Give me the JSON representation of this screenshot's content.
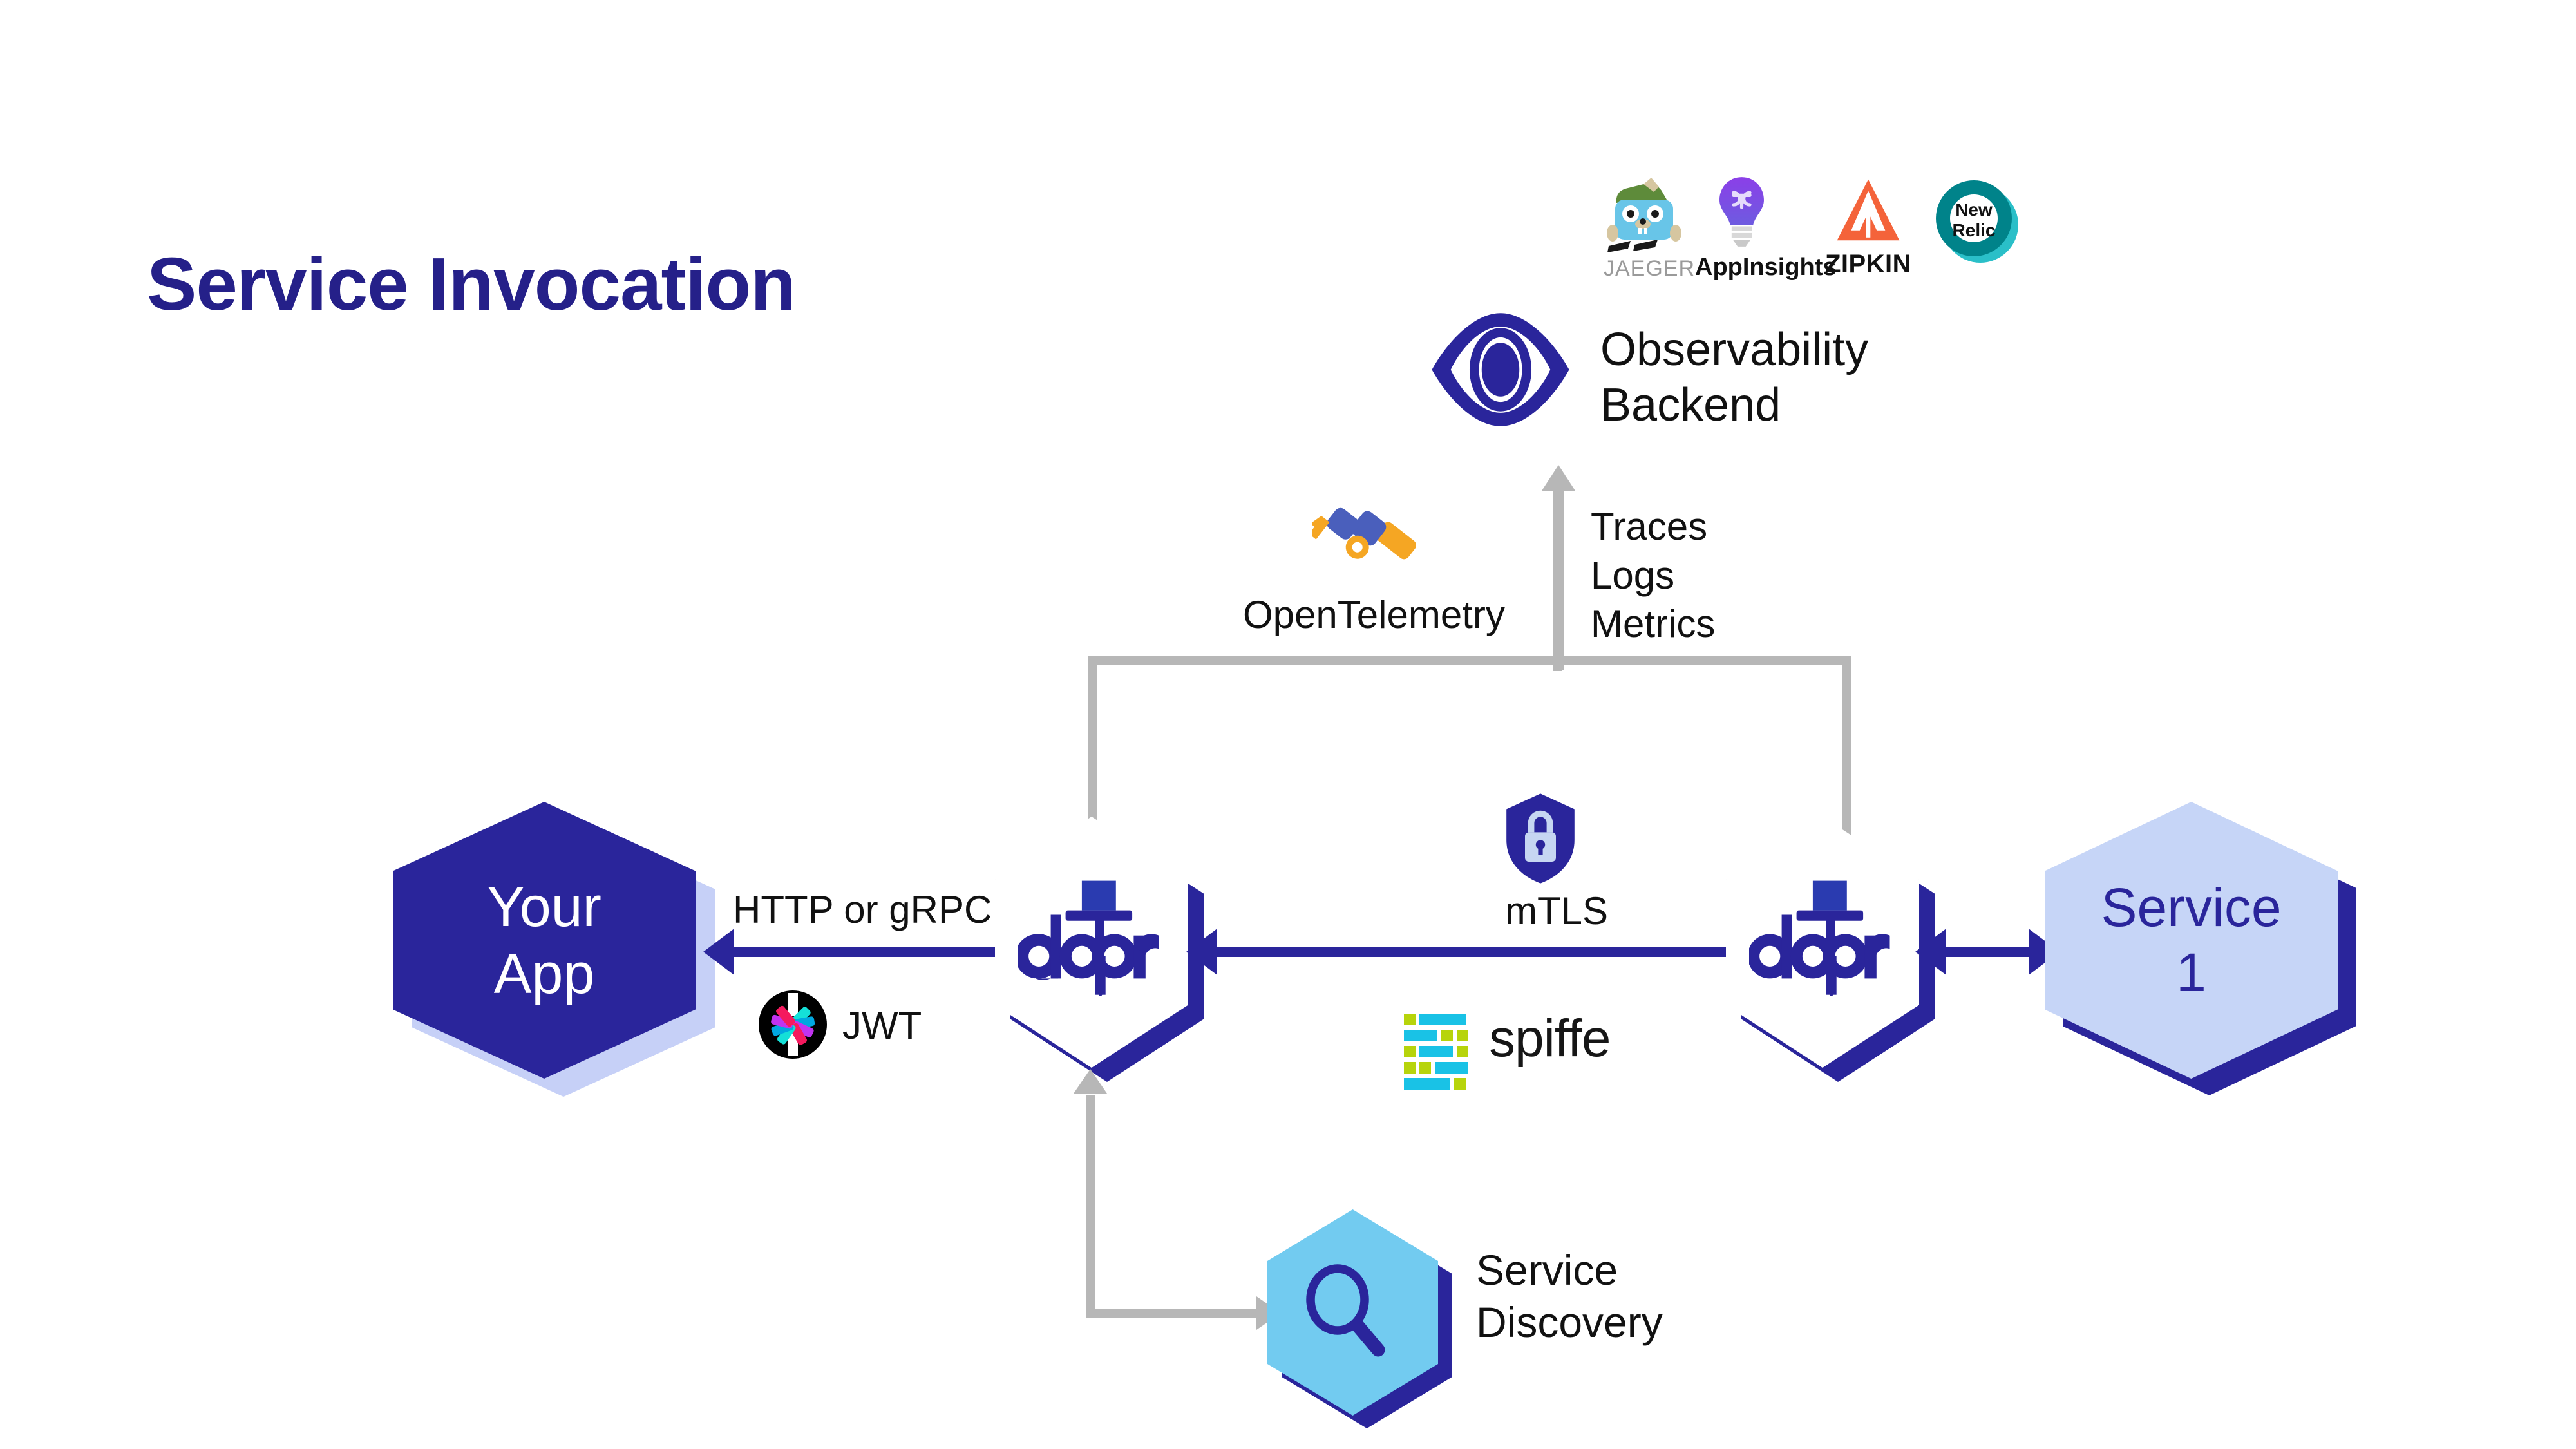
{
  "title": "Service Invocation",
  "nodes": {
    "your_app": {
      "label": "Your\nApp",
      "fill": "#2A259B",
      "shadow": "#C6D0F7",
      "text": "#FFFFFF"
    },
    "dapr_left": {
      "label": "dapr",
      "fill": "#FFFFFF",
      "shadow": "#2A259B",
      "text": "#2A259B"
    },
    "dapr_right": {
      "label": "dapr",
      "fill": "#FFFFFF",
      "shadow": "#2A259B",
      "text": "#2A259B"
    },
    "service_one": {
      "label": "Service\n1",
      "fill": "#C6D5F7",
      "shadow": "#2A259B",
      "text": "#2A259B"
    },
    "service_discovery": {
      "label": "Service\nDiscovery",
      "fill": "#72CBF0",
      "shadow": "#2A259B",
      "icon": "magnifier-icon"
    },
    "observability": {
      "label": "Observability\nBackend",
      "icon": "eye-icon",
      "color": "#2A259B"
    }
  },
  "edges": {
    "app_to_dapr": "HTTP or gRPC",
    "dapr_to_dapr": "mTLS",
    "telemetry": "Traces\nLogs\nMetrics"
  },
  "annotations": {
    "jwt": "JWT",
    "opentelemetry": "OpenTelemetry",
    "spiffe": "spiffe",
    "mtls": "mTLS"
  },
  "vendors": [
    {
      "name": "JAEGER",
      "label": "JAEGER",
      "icon": "jaeger-gopher-icon",
      "color": "#6AC5E0"
    },
    {
      "name": "AppInsights",
      "label": "AppInsights",
      "icon": "lightbulb-icon",
      "color": "#7B3FE4"
    },
    {
      "name": "ZIPKIN",
      "label": "ZIPKIN",
      "icon": "zipkin-triangle-icon",
      "color": "#F4633A"
    },
    {
      "name": "New Relic",
      "label": "New\nRelic",
      "icon": "newrelic-ring-icon",
      "color": "#00838A"
    }
  ],
  "colors": {
    "navy": "#2A259B",
    "title_navy": "#252089",
    "light_blue": "#C6D5F7",
    "sky_blue": "#72CBF0",
    "gray_line": "#B7B7B7",
    "spiffe_cyan": "#19C2E6",
    "spiffe_lime": "#B7D40B",
    "otel_orange": "#F5A623",
    "otel_blue": "#4A5FBC"
  }
}
